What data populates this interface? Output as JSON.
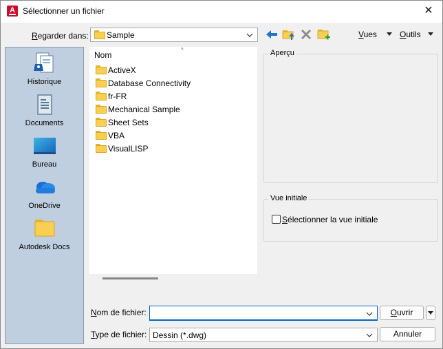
{
  "window": {
    "title": "Sélectionner un fichier",
    "close_glyph": "✕"
  },
  "lookin": {
    "label_underlined": "R",
    "label_rest": "egarder dans:",
    "value": "Sample"
  },
  "toolbar": {
    "views_underlined": "V",
    "views_rest": "ues",
    "tools_underlined": "O",
    "tools_rest": "utils"
  },
  "places": [
    {
      "label": "Historique",
      "icon": "history-icon"
    },
    {
      "label": "Documents",
      "icon": "documents-icon"
    },
    {
      "label": "Bureau",
      "icon": "desktop-icon"
    },
    {
      "label": "OneDrive",
      "icon": "onedrive-icon"
    },
    {
      "label": "Autodesk Docs",
      "icon": "autodesk-docs-folder-icon"
    }
  ],
  "filelist": {
    "column": "Nom",
    "sort_caret": "^",
    "items": [
      "ActiveX",
      "Database Connectivity",
      "fr-FR",
      "Mechanical Sample",
      "Sheet Sets",
      "VBA",
      "VisualLISP"
    ]
  },
  "preview": {
    "title": "Aperçu"
  },
  "initial_view": {
    "title": "Vue initiale",
    "checkbox_underlined": "S",
    "checkbox_rest": "électionner la vue initiale",
    "checked": false
  },
  "filename": {
    "label_underlined": "N",
    "label_rest": "om de fichier:",
    "value": ""
  },
  "filetype": {
    "label_underlined": "T",
    "label_rest": "ype de fichier:",
    "value": "Dessin (*.dwg)"
  },
  "buttons": {
    "open_underlined": "O",
    "open_rest": "uvrir",
    "cancel": "Annuler"
  },
  "colors": {
    "places_bg": "#bfcfdf",
    "folder": "#f8cf50",
    "accent_blue": "#1e74c8",
    "app_red": "#c8102e"
  }
}
